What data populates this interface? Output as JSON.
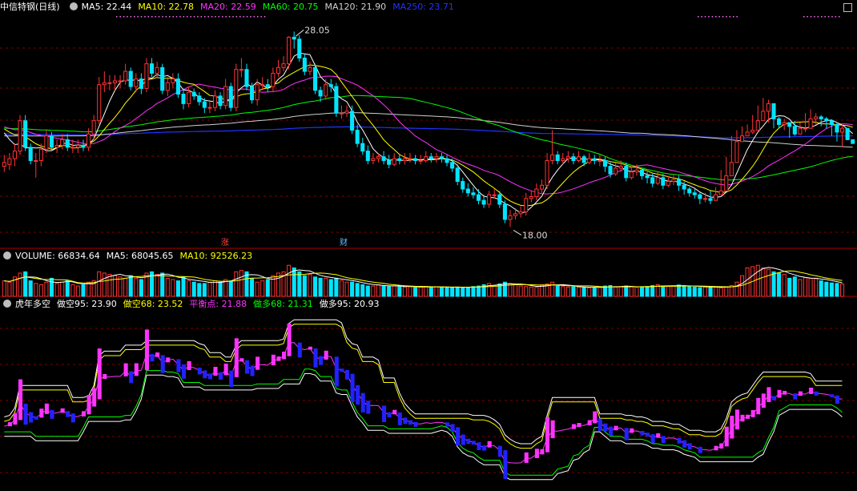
{
  "colors": {
    "up": "#ff3333",
    "down": "#00e5ff",
    "grid": "#7f0000",
    "ma5": "#ffffff",
    "ma10": "#ffff00",
    "ma20": "#ff33ff",
    "ma60": "#00ff00",
    "ma120": "#d0d0d0",
    "ma250": "#2233ff",
    "dk95": "#ffffff",
    "dk68": "#ffff00",
    "mid": "#ff33ff",
    "dd68": "#00ff00",
    "dd95": "#ffffff",
    "bar_pos": "#ff33ff",
    "bar_neg": "#2222ff"
  },
  "price_panel": {
    "stock_name": "中信特钢(日线)",
    "legend": [
      {
        "label": "MA5: 22.44",
        "color": "#ffffff"
      },
      {
        "label": "MA10: 22.78",
        "color": "#ffff00"
      },
      {
        "label": "MA20: 22.59",
        "color": "#ff33ff"
      },
      {
        "label": "MA60: 20.75",
        "color": "#00ff00"
      },
      {
        "label": "MA120: 21.90",
        "color": "#d0d0d0"
      },
      {
        "label": "MA250: 23.71",
        "color": "#2233ff"
      }
    ],
    "high_marker": "28.05",
    "low_marker": "18.00",
    "event_zhang": "涨",
    "event_cai": "财"
  },
  "volume_panel": {
    "legend": [
      {
        "label": "VOLUME: 66834.64",
        "color": "#ffffff"
      },
      {
        "label": "MA5: 68045.65",
        "color": "#ffffff"
      },
      {
        "label": "MA10: 92526.23",
        "color": "#ffff00"
      }
    ]
  },
  "indicator_panel": {
    "legend": [
      {
        "label": "虎年多空",
        "color": "#ffffff"
      },
      {
        "label": "做空95: 23.90",
        "color": "#ffffff"
      },
      {
        "label": "做空68: 23.52",
        "color": "#ffff00"
      },
      {
        "label": "平衡点: 21.88",
        "color": "#ff33ff"
      },
      {
        "label": "做多68: 21.31",
        "color": "#00ff00"
      },
      {
        "label": "做多95: 20.93",
        "color": "#ffffff"
      }
    ]
  },
  "chart_data": [
    {
      "type": "candlestick",
      "ylim": [
        17.3,
        29.2
      ],
      "close": [
        21.4,
        21.6,
        22.0,
        23.6,
        22.2,
        21.5,
        21.5,
        22.1,
        22.8,
        22.2,
        22.3,
        22.6,
        22.2,
        22.2,
        22.3,
        22.2,
        22.9,
        23.6,
        25.5,
        25.6,
        25.6,
        25.7,
        25.7,
        26.2,
        25.4,
        25.8,
        25.3,
        26.6,
        26.1,
        26.4,
        25.2,
        25.6,
        25.8,
        25.0,
        24.5,
        25.1,
        24.9,
        24.6,
        24.3,
        24.3,
        24.9,
        24.4,
        25.4,
        24.3,
        26.3,
        26.3,
        25.4,
        24.7,
        25.5,
        25.5,
        25.4,
        26.1,
        26.4,
        26.6,
        28.0,
        27.9,
        26.9,
        26.2,
        26.4,
        25.2,
        24.9,
        25.5,
        25.4,
        24.0,
        24.0,
        24.1,
        23.1,
        22.4,
        22.0,
        21.5,
        21.6,
        21.7,
        21.5,
        21.3,
        21.6,
        21.5,
        21.6,
        21.6,
        21.5,
        21.5,
        21.7,
        21.6,
        21.7,
        21.6,
        21.4,
        21.1,
        20.4,
        20.0,
        19.8,
        19.7,
        19.4,
        19.2,
        19.7,
        19.7,
        19.2,
        18.4,
        18.6,
        18.7,
        18.8,
        19.5,
        19.6,
        20.0,
        20.2,
        21.5,
        21.8,
        21.5,
        21.6,
        21.7,
        21.5,
        21.7,
        21.4,
        21.6,
        21.5,
        21.5,
        21.2,
        20.8,
        21.1,
        21.2,
        20.6,
        20.9,
        21.0,
        20.7,
        20.6,
        20.3,
        20.6,
        20.2,
        20.4,
        20.5,
        20.2,
        20.0,
        19.8,
        19.7,
        19.5,
        19.5,
        19.4,
        19.7,
        19.9,
        20.7,
        21.4,
        22.5,
        22.8,
        23.0,
        23.1,
        23.6,
        24.1,
        24.5,
        23.7,
        23.4,
        23.5,
        23.3,
        22.9,
        23.2,
        23.2,
        23.7,
        23.8,
        23.7,
        23.6,
        23.4,
        23.0,
        23.2,
        22.6,
        22.4
      ],
      "open": [
        21.2,
        21.3,
        21.6,
        22.0,
        23.6,
        22.2,
        21.5,
        21.5,
        22.1,
        22.8,
        22.2,
        22.3,
        22.6,
        22.2,
        22.2,
        22.3,
        22.2,
        22.9,
        23.6,
        25.5,
        25.6,
        25.6,
        25.7,
        25.7,
        26.2,
        25.4,
        25.8,
        25.3,
        26.6,
        26.1,
        26.4,
        25.2,
        25.6,
        25.8,
        25.0,
        24.5,
        25.1,
        24.9,
        24.6,
        24.3,
        24.3,
        24.9,
        24.4,
        25.4,
        24.3,
        26.3,
        26.3,
        25.4,
        24.7,
        25.5,
        25.5,
        25.4,
        26.1,
        26.4,
        26.6,
        28.0,
        27.9,
        26.9,
        26.2,
        26.4,
        25.2,
        24.9,
        25.5,
        25.4,
        24.0,
        24.0,
        24.1,
        23.1,
        22.4,
        22.0,
        21.5,
        21.6,
        21.7,
        21.5,
        21.3,
        21.6,
        21.5,
        21.6,
        21.6,
        21.5,
        21.5,
        21.7,
        21.6,
        21.7,
        21.6,
        21.4,
        21.1,
        20.4,
        20.0,
        19.8,
        19.7,
        19.4,
        19.2,
        19.7,
        19.7,
        19.2,
        18.4,
        18.6,
        18.7,
        18.8,
        19.5,
        19.6,
        20.0,
        20.2,
        21.5,
        21.8,
        21.5,
        21.6,
        21.7,
        21.5,
        21.7,
        21.4,
        21.6,
        21.5,
        21.5,
        21.2,
        20.8,
        21.1,
        21.2,
        20.6,
        20.9,
        21.0,
        20.7,
        20.6,
        20.3,
        20.6,
        20.2,
        20.4,
        20.5,
        20.2,
        20.0,
        19.8,
        19.7,
        19.5,
        19.5,
        19.4,
        19.7,
        19.9,
        20.7,
        21.4,
        22.5,
        22.8,
        23.0,
        23.1,
        23.6,
        24.1,
        24.5,
        23.7,
        23.4,
        23.5,
        23.3,
        22.9,
        23.2,
        23.2,
        23.7,
        23.8,
        23.7,
        23.6,
        23.4,
        23.0,
        23.2,
        22.6
      ],
      "high": [
        21.8,
        21.9,
        22.4,
        23.9,
        23.9,
        22.4,
        21.9,
        22.4,
        23.1,
        23.0,
        22.6,
        22.9,
        22.9,
        22.6,
        22.6,
        22.6,
        23.2,
        23.9,
        25.9,
        26.2,
        26.0,
        26.0,
        26.0,
        26.6,
        26.4,
        26.1,
        26.1,
        26.9,
        26.9,
        26.7,
        26.6,
        25.9,
        26.1,
        26.1,
        25.3,
        25.4,
        25.3,
        25.1,
        24.8,
        24.6,
        25.2,
        25.1,
        25.8,
        25.6,
        26.6,
        26.9,
        26.6,
        25.6,
        25.8,
        25.9,
        25.8,
        26.4,
        26.8,
        27.0,
        28.05,
        28.3,
        28.1,
        27.1,
        26.7,
        26.6,
        25.4,
        25.8,
        25.8,
        25.6,
        24.4,
        24.4,
        24.4,
        23.4,
        22.7,
        22.3,
        21.9,
        21.9,
        22.0,
        21.8,
        21.9,
        21.8,
        21.9,
        21.9,
        21.8,
        21.8,
        22.0,
        21.9,
        21.9,
        21.9,
        21.8,
        21.6,
        21.3,
        20.6,
        20.3,
        20.1,
        20.0,
        19.7,
        19.9,
        20.0,
        19.9,
        19.4,
        18.9,
        19.0,
        19.1,
        19.8,
        19.9,
        20.3,
        20.5,
        21.9,
        23.1,
        22.0,
        21.9,
        22.0,
        21.9,
        22.0,
        21.8,
        21.9,
        21.8,
        21.8,
        21.7,
        21.4,
        21.4,
        21.5,
        21.4,
        21.2,
        21.3,
        21.1,
        20.9,
        20.8,
        20.9,
        20.8,
        20.7,
        20.8,
        20.7,
        20.4,
        20.1,
        20.0,
        19.8,
        19.8,
        19.9,
        20.1,
        21.0,
        21.7,
        22.8,
        23.1,
        23.3,
        23.4,
        23.9,
        24.4,
        24.8,
        24.7,
        24.0,
        23.8,
        23.7,
        23.4,
        23.6,
        23.5,
        24.0,
        24.2,
        24.0,
        23.9,
        23.8,
        23.6,
        23.5,
        23.4
      ],
      "low": [
        20.9,
        21.0,
        21.2,
        21.8,
        22.0,
        21.3,
        20.6,
        21.2,
        21.9,
        22.0,
        21.9,
        22.1,
        22.0,
        21.9,
        21.9,
        22.0,
        22.0,
        22.6,
        23.4,
        25.1,
        25.2,
        25.2,
        25.3,
        25.5,
        25.2,
        25.1,
        25.0,
        25.1,
        25.9,
        25.9,
        25.0,
        24.9,
        25.3,
        24.8,
        24.2,
        24.3,
        24.7,
        24.4,
        24.0,
        24.0,
        24.1,
        24.2,
        24.2,
        24.1,
        24.1,
        25.9,
        25.2,
        24.5,
        24.4,
        25.2,
        25.1,
        25.1,
        25.9,
        26.2,
        26.3,
        27.4,
        26.7,
        26.0,
        26.0,
        25.0,
        24.6,
        24.7,
        25.1,
        23.8,
        23.7,
        23.8,
        22.9,
        22.2,
        21.8,
        21.3,
        21.3,
        21.4,
        21.3,
        21.1,
        21.2,
        21.3,
        21.3,
        21.4,
        21.3,
        21.3,
        21.4,
        21.4,
        21.4,
        21.4,
        21.2,
        20.9,
        20.2,
        19.8,
        19.6,
        19.5,
        19.2,
        19.0,
        19.0,
        19.5,
        19.0,
        18.2,
        18.0,
        18.4,
        18.5,
        18.6,
        19.3,
        19.4,
        19.8,
        20.0,
        21.3,
        21.3,
        21.3,
        21.4,
        21.3,
        21.4,
        21.2,
        21.3,
        21.3,
        21.2,
        20.9,
        20.6,
        20.7,
        20.9,
        20.4,
        20.5,
        20.7,
        20.5,
        20.3,
        20.1,
        20.2,
        20.0,
        20.1,
        20.2,
        19.9,
        19.7,
        19.6,
        19.5,
        19.2,
        19.3,
        19.2,
        19.5,
        19.7,
        20.5,
        21.2,
        22.3,
        22.5,
        22.8,
        22.9,
        23.3,
        23.8,
        23.5,
        23.2,
        23.2,
        23.1,
        22.7,
        22.8,
        23.0,
        23.0,
        23.5,
        23.4,
        23.3,
        23.2,
        22.8,
        22.5,
        22.2
      ]
    },
    {
      "type": "bar",
      "name": "VOLUME",
      "values": [
        60,
        55,
        75,
        90,
        95,
        60,
        50,
        45,
        55,
        70,
        50,
        55,
        60,
        45,
        40,
        45,
        55,
        60,
        95,
        90,
        85,
        80,
        75,
        70,
        80,
        70,
        65,
        90,
        95,
        85,
        90,
        70,
        65,
        60,
        75,
        60,
        55,
        50,
        50,
        55,
        60,
        55,
        65,
        60,
        95,
        100,
        95,
        70,
        55,
        60,
        65,
        80,
        90,
        95,
        120,
        110,
        95,
        80,
        85,
        75,
        70,
        70,
        65,
        70,
        60,
        55,
        55,
        50,
        45,
        40,
        40,
        45,
        40,
        38,
        40,
        38,
        36,
        38,
        35,
        36,
        38,
        36,
        37,
        35,
        34,
        35,
        36,
        34,
        35,
        38,
        40,
        45,
        50,
        42,
        48,
        55,
        50,
        45,
        40,
        38,
        36,
        35,
        45,
        48,
        55,
        40,
        38,
        36,
        38,
        36,
        35,
        33,
        34,
        35,
        40,
        42,
        36,
        38,
        40,
        37,
        35,
        36,
        38,
        42,
        45,
        40,
        38,
        40,
        44,
        42,
        38,
        36,
        34,
        36,
        38,
        35,
        33,
        36,
        42,
        55,
        80,
        110,
        115,
        120,
        110,
        105,
        95,
        90,
        85,
        70,
        75,
        65,
        72,
        70,
        68,
        60,
        55,
        52,
        50,
        48
      ]
    }
  ]
}
